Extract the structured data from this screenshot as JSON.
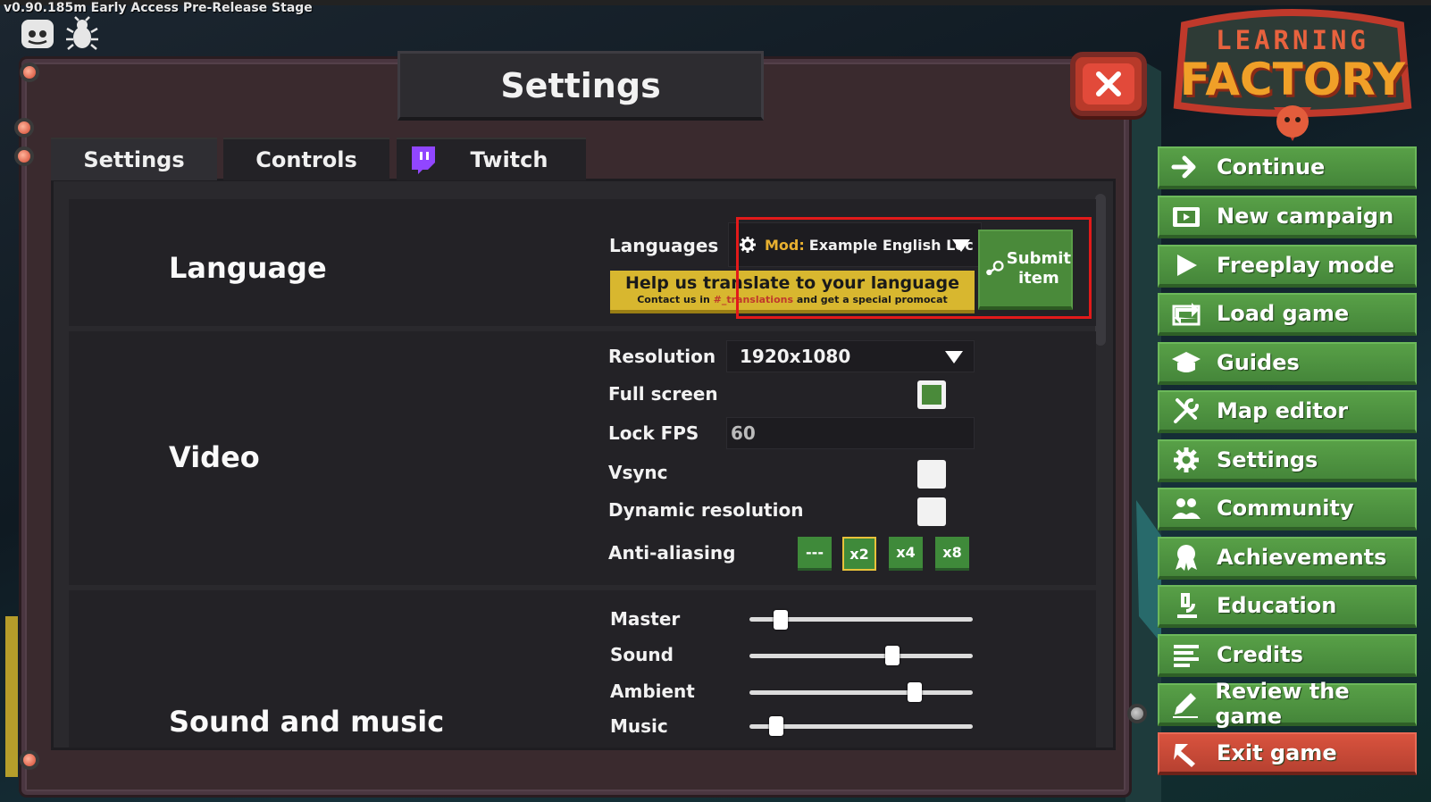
{
  "version": "v0.90.185m Early Access Pre-Release Stage",
  "window": {
    "title": "Settings",
    "tabs": [
      {
        "label": "Settings",
        "active": true
      },
      {
        "label": "Controls",
        "active": false
      },
      {
        "label": "Twitch",
        "active": false,
        "icon": "twitch-icon"
      }
    ]
  },
  "language": {
    "section_title": "Language",
    "languages_label": "Languages",
    "mod_prefix": "Mod:",
    "selected_language": "Example English Loc",
    "help_title": "Help us translate to your language",
    "help_sub_prefix": "Contact us in",
    "help_sub_channel": "#_translations",
    "help_sub_suffix": "and get a special promocat",
    "submit_label_1": "Submit",
    "submit_label_2": "item"
  },
  "video": {
    "section_title": "Video",
    "resolution_label": "Resolution",
    "resolution_value": "1920x1080",
    "fullscreen_label": "Full screen",
    "fullscreen_checked": true,
    "lockfps_label": "Lock FPS",
    "lockfps_value": "60",
    "vsync_label": "Vsync",
    "vsync_checked": false,
    "dynres_label": "Dynamic resolution",
    "dynres_checked": false,
    "aa_label": "Anti-aliasing",
    "aa_options": [
      "---",
      "x2",
      "x4",
      "x8"
    ],
    "aa_selected": "x2"
  },
  "sound": {
    "section_title": "Sound and music",
    "master_label": "Master",
    "master_value": 0.14,
    "sound_label": "Sound",
    "sound_value": 0.64,
    "ambient_label": "Ambient",
    "ambient_value": 0.74,
    "music_label": "Music",
    "music_value": 0.12
  },
  "logo": {
    "line1": "LEARNING",
    "line2": "FACTORY"
  },
  "menu": [
    {
      "label": "Continue",
      "icon": "arrow-right-icon"
    },
    {
      "label": "New campaign",
      "icon": "film-icon"
    },
    {
      "label": "Freeplay mode",
      "icon": "play-icon"
    },
    {
      "label": "Load game",
      "icon": "reload-icon"
    },
    {
      "label": "Guides",
      "icon": "graduation-cap-icon"
    },
    {
      "label": "Map editor",
      "icon": "tools-icon"
    },
    {
      "label": "Settings",
      "icon": "gear-icon"
    },
    {
      "label": "Community",
      "icon": "people-icon"
    },
    {
      "label": "Achievements",
      "icon": "award-icon"
    },
    {
      "label": "Education",
      "icon": "microscope-icon"
    },
    {
      "label": "Credits",
      "icon": "list-icon"
    },
    {
      "label": "Review the game",
      "icon": "pen-icon"
    },
    {
      "label": "Exit game",
      "icon": "exit-icon"
    }
  ],
  "colors": {
    "menu_green": "#58a047",
    "exit_red": "#d9533e",
    "highlight": "#e21a1a",
    "banner_yellow": "#d8b72f"
  }
}
